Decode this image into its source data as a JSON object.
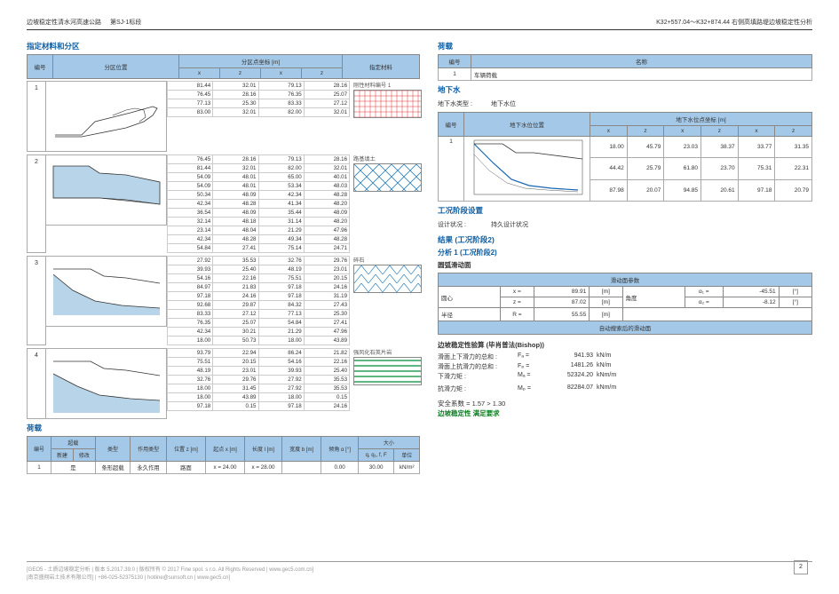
{
  "header": {
    "left1": "边坡稳定性清水河高速公路",
    "left2": "第SJ-1标段",
    "right": "K32+557.04～K32+874.44 右侧高填路堤边坡稳定性分析"
  },
  "sec_materials_title": "指定材料和分区",
  "mat_headers": {
    "no": "编号",
    "pos": "分区位置",
    "coords": "分区点坐标 [m]",
    "assigned": "指定材料",
    "x": "x",
    "z": "z"
  },
  "materials": [
    {
      "no": "1",
      "label": "刚性材料编号 1",
      "coords": [
        [
          "81.44",
          "32.01",
          "79.13",
          "28.16"
        ],
        [
          "76.45",
          "28.16",
          "76.35",
          "25.07"
        ],
        [
          "77.13",
          "25.30",
          "83.33",
          "27.12"
        ],
        [
          "83.00",
          "32.01",
          "82.00",
          "32.01"
        ]
      ],
      "pattern": "grid-red"
    },
    {
      "no": "2",
      "label": "路基填土",
      "coords": [
        [
          "76.45",
          "28.16",
          "79.13",
          "28.16"
        ],
        [
          "81.44",
          "32.01",
          "82.00",
          "32.01"
        ],
        [
          "54.09",
          "48.01",
          "65.00",
          "40.01"
        ],
        [
          "54.09",
          "48.01",
          "53.34",
          "48.03"
        ],
        [
          "50.34",
          "48.09",
          "42.34",
          "48.28"
        ],
        [
          "42.34",
          "48.28",
          "41.34",
          "48.20"
        ],
        [
          "36.54",
          "48.09",
          "35.44",
          "48.09"
        ],
        [
          "32.14",
          "48.18",
          "31.14",
          "48.20"
        ],
        [
          "23.14",
          "48.04",
          "21.29",
          "47.96"
        ],
        [
          "42.34",
          "48.28",
          "49.34",
          "48.28"
        ],
        [
          "54.84",
          "27.41",
          "75.14",
          "24.71"
        ]
      ],
      "pattern": "cross-blue"
    },
    {
      "no": "3",
      "label": "碎石",
      "coords": [
        [
          "27.92",
          "35.53",
          "32.76",
          "29.76"
        ],
        [
          "39.93",
          "25.40",
          "48.19",
          "23.01"
        ],
        [
          "54.16",
          "22.16",
          "75.51",
          "20.15"
        ],
        [
          "84.97",
          "21.83",
          "97.18",
          "24.16"
        ],
        [
          "97.18",
          "24.16",
          "97.18",
          "31.19"
        ],
        [
          "92.68",
          "29.87",
          "84.32",
          "27.43"
        ],
        [
          "83.33",
          "27.12",
          "77.13",
          "25.30"
        ],
        [
          "76.35",
          "25.07",
          "54.84",
          "27.41"
        ],
        [
          "42.34",
          "30.21",
          "21.29",
          "47.96"
        ],
        [
          "18.00",
          "50.73",
          "18.00",
          "43.89"
        ]
      ],
      "pattern": "triangles"
    },
    {
      "no": "4",
      "label": "强风化石英片岩",
      "coords": [
        [
          "93.79",
          "22.94",
          "86.24",
          "21.82"
        ],
        [
          "75.51",
          "20.15",
          "54.16",
          "22.16"
        ],
        [
          "48.19",
          "23.01",
          "39.93",
          "25.40"
        ],
        [
          "32.76",
          "29.76",
          "27.92",
          "35.53"
        ],
        [
          "18.00",
          "31.45",
          "27.92",
          "35.53"
        ],
        [
          "18.00",
          "43.89",
          "18.00",
          "0.15"
        ],
        [
          "97.18",
          "0.15",
          "97.18",
          "24.16"
        ]
      ],
      "pattern": "lines-green"
    }
  ],
  "sec_load_title": "荷载",
  "load_headers": {
    "no": "编号",
    "sc": "超载",
    "new": "新建",
    "edit": "修改",
    "type": "类型",
    "action": "作用类型",
    "pos": "位置 z [m]",
    "start": "起点 x [m]",
    "len": "长度 l [m]",
    "width": "宽度 b [m]",
    "slope": "倾角 α [°]",
    "mag": "大小",
    "q": "q, q₁, f, F",
    "unit": "单位"
  },
  "loads": [
    {
      "no": "1",
      "name": "是",
      "type": "条形超载",
      "action": "永久作用",
      "pos": "路面",
      "start": "x = 24.00",
      "len": "x = 28.00",
      "width": "",
      "slope": "0.00",
      "q": "30.00",
      "unit": "kN/m²"
    }
  ],
  "sec_sc_title": "荷载",
  "sc_headers": {
    "no": "编号",
    "name": "名称"
  },
  "sc_rows": [
    {
      "no": "1",
      "name": "车辆荷载"
    }
  ],
  "sec_gw_title": "地下水",
  "gw_type_label": "地下水类型 :",
  "gw_type_value": "地下水位",
  "gw_headers": {
    "no": "编号",
    "pos": "地下水位位置",
    "coords": "地下水位点坐标 [m]",
    "x": "x",
    "z": "z"
  },
  "gw_coords": [
    [
      "18.00",
      "45.79",
      "23.03",
      "38.37",
      "33.77",
      "31.35"
    ],
    [
      "44.42",
      "25.79",
      "61.80",
      "23.70",
      "75.31",
      "22.31"
    ],
    [
      "87.98",
      "20.07",
      "94.85",
      "20.61",
      "97.18",
      "20.79"
    ]
  ],
  "sec_stage_title": "工况阶段设置",
  "stage_label": "设计状况 :",
  "stage_value": "持久设计状况",
  "results_title": "结果 (工况阶段2)",
  "analysis_title": "分析 1 (工况阶段2)",
  "circular_title": "圆弧滑动面",
  "slide_param_header": "滑动面参数",
  "slide_params": {
    "center_label": "圆心",
    "x": "89.91",
    "x_unit": "[m]",
    "z": "87.02",
    "z_unit": "[m]",
    "angle_label": "角度",
    "a1_label": "α₁ =",
    "a1": "-45.51",
    "a1_unit": "[°]",
    "a2_label": "α₂ =",
    "a2": "-8.12",
    "a2_unit": "[°]",
    "radius_label": "半径",
    "R": "55.55",
    "R_unit": "[m]",
    "auto": "自动搜索后的滑动面"
  },
  "bishop_title": "边坡稳定性验算 (毕肖普法(Bishop))",
  "bishop": {
    "r1_label": "滑面上下滑力的总和 :",
    "r1_sym": "Fₐ =",
    "r1_val": "941.93",
    "r1_unit": "kN/m",
    "r2_label": "滑面上抗滑力的总和 :",
    "r2_sym": "Fₚ =",
    "r2_val": "1481.26",
    "r2_unit": "kN/m",
    "r3_label": "下滑力矩 :",
    "r3_sym": "Mₐ =",
    "r3_val": "52324.20",
    "r3_unit": "kNm/m",
    "r4_label": "抗滑力矩 :",
    "r4_sym": "Mₚ =",
    "r4_val": "82284.07",
    "r4_unit": "kNm/m",
    "fs_label": "安全系数 = 1.57 > 1.30",
    "ok": "边坡稳定性 满足要求"
  },
  "footer": {
    "left": "[GEO5 - 土质边坡稳定分析 | 版本 5.2017.39.0 | 版权所有 © 2017 Fine spol. s r.o. All Rights Reserved | www.gec5.com.cn]",
    "left2": "[南京盛翔岩土技术有限公司] | +86-025-52375130 | hotline@sunsoft.cn | www.gec5.cn]",
    "page": "2"
  }
}
